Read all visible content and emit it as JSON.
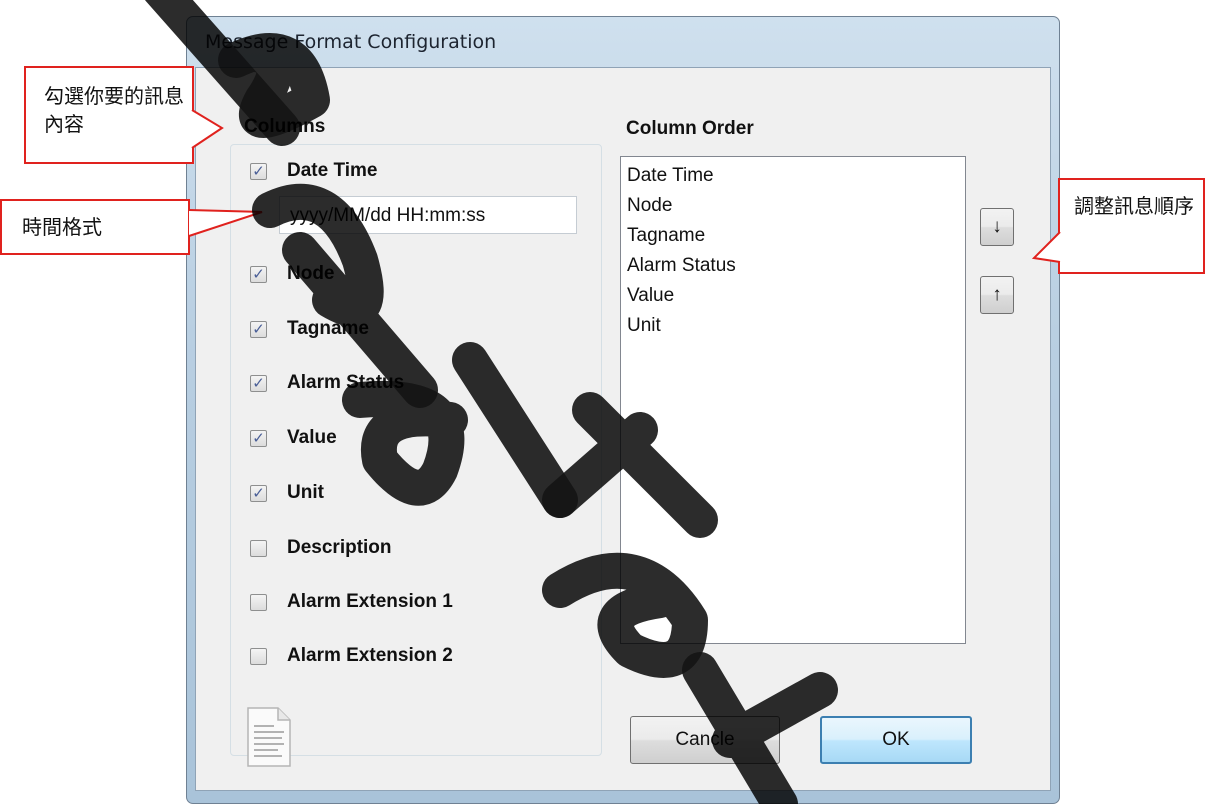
{
  "top_caption": "",
  "window": {
    "title": "Message Format Configuration"
  },
  "columns_group": {
    "label": "Columns",
    "items": [
      {
        "label": "Date Time",
        "checked": true
      },
      {
        "label": "Node",
        "checked": true
      },
      {
        "label": "Tagname",
        "checked": true
      },
      {
        "label": "Alarm Status",
        "checked": true
      },
      {
        "label": "Value",
        "checked": true
      },
      {
        "label": "Unit",
        "checked": true
      },
      {
        "label": "Description",
        "checked": false
      },
      {
        "label": "Alarm Extension 1",
        "checked": false
      },
      {
        "label": "Alarm Extension 2",
        "checked": false
      }
    ],
    "date_format_value": "yyyy/MM/dd HH:mm:ss"
  },
  "column_order": {
    "label": "Column Order",
    "items": [
      "Date Time",
      "Node",
      "Tagname",
      "Alarm Status",
      "Value",
      "Unit"
    ],
    "move_down_label": "↓",
    "move_up_label": "↑"
  },
  "footer": {
    "cancel_label": "Cancle",
    "ok_label": "OK"
  },
  "annotations": {
    "select_content": "勾選你要的訊息內容",
    "time_format": "時間格式",
    "adjust_order": "調整訊息順序"
  },
  "colors": {
    "callout_border": "#e0221e",
    "window_frame": "#b9cfe2",
    "client_bg": "#f0f0f0"
  }
}
